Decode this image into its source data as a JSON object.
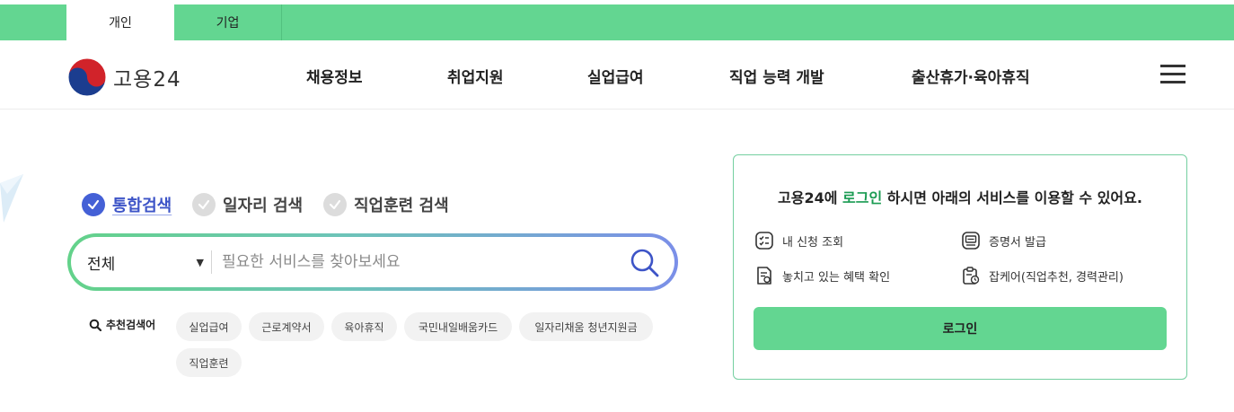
{
  "top_tabs": [
    {
      "label": "개인",
      "active": true
    },
    {
      "label": "기업",
      "active": false
    }
  ],
  "header": {
    "logo_text": "고용24",
    "nav": [
      "채용정보",
      "취업지원",
      "실업급여",
      "직업 능력 개발",
      "출산휴가·육아휴직"
    ],
    "menu_icon": "hamburger-icon"
  },
  "search": {
    "tabs": [
      {
        "label": "통합검색",
        "selected": true
      },
      {
        "label": "일자리 검색",
        "selected": false
      },
      {
        "label": "직업훈련 검색",
        "selected": false
      }
    ],
    "scope_value": "전체",
    "placeholder": "필요한 서비스를 찾아보세요",
    "recommended_label": "추천검색어",
    "recommended": [
      "실업급여",
      "근로계약서",
      "육아휴직",
      "국민내일배움카드",
      "일자리채움 청년지원금",
      "직업훈련"
    ]
  },
  "login_panel": {
    "title_prefix": "고용24에 ",
    "title_accent": "로그인",
    "title_suffix": " 하시면 아래의 서비스를 이용할 수 있어요.",
    "services": [
      {
        "label": "내 신청 조회",
        "icon": "checklist-icon"
      },
      {
        "label": "증명서 발급",
        "icon": "certificate-icon"
      },
      {
        "label": "놓치고 있는 혜택 확인",
        "icon": "benefit-check-icon"
      },
      {
        "label": "잡케어(직업추천, 경력관리)",
        "icon": "job-care-icon"
      }
    ],
    "button_label": "로그인"
  },
  "colors": {
    "brand_green": "#63d691",
    "accent_blue": "#4460d6",
    "title_accent_green": "#1a9b52"
  }
}
